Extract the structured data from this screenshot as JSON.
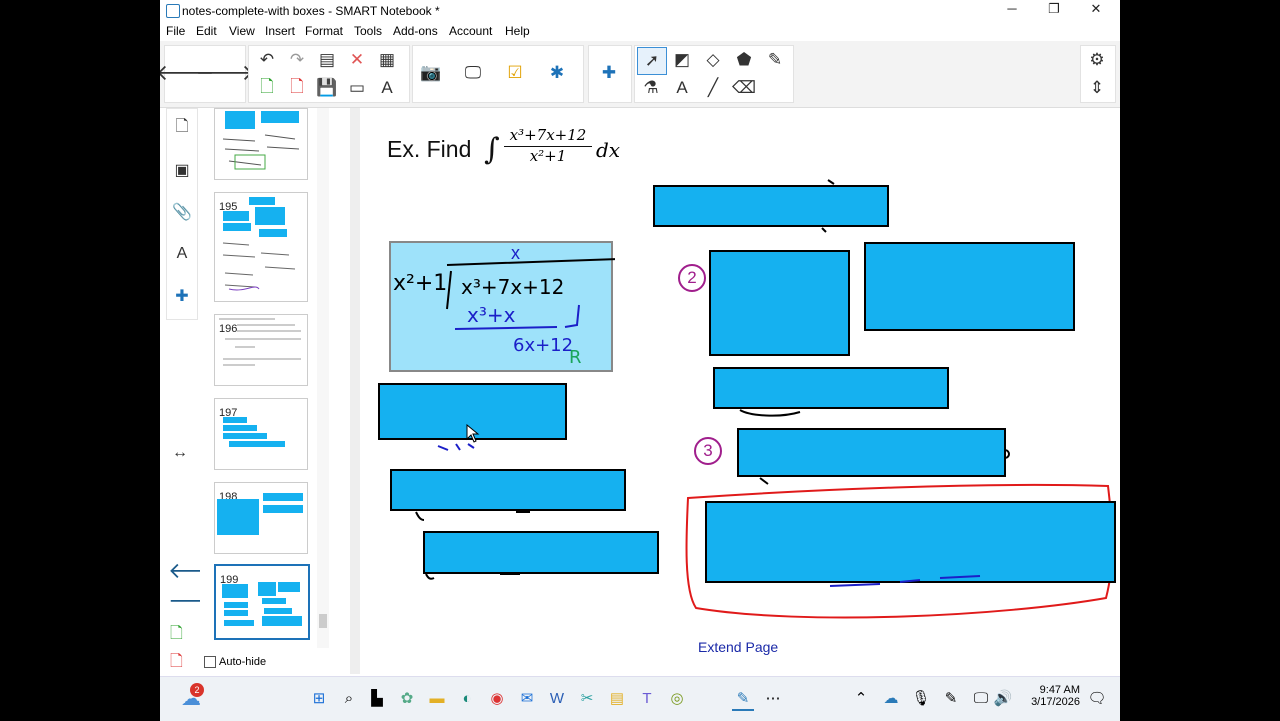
{
  "window": {
    "title": "notes-complete-with boxes - SMART Notebook *",
    "minimize": "─",
    "maximize": "❐",
    "close": "✕"
  },
  "menu": [
    "File",
    "Edit",
    "View",
    "Insert",
    "Format",
    "Tools",
    "Add-ons",
    "Account",
    "Help"
  ],
  "toolbar": {
    "back": "🡐",
    "forward": "🡒",
    "undo": "↶",
    "redo": "↷",
    "delete": "✕",
    "select_icon": "select-arrow-icon",
    "pen_icon": "pen-icon",
    "text_icon": "A"
  },
  "pages": [
    {
      "num": ""
    },
    {
      "num": "195"
    },
    {
      "num": "196"
    },
    {
      "num": "197"
    },
    {
      "num": "198"
    },
    {
      "num": "199"
    }
  ],
  "autohide_label": "Auto-hide",
  "canvas": {
    "prompt": "Ex. Find",
    "integral_num": "x³+7x+12",
    "integral_den": "x²+1",
    "dx": "dx",
    "work_divisor": "x²+1",
    "work_dividend": "x³+7x+12",
    "work_quotient": "x",
    "work_sub": "x³+x",
    "work_remainder": "6x+12",
    "work_r_label": "R",
    "circled_2": "2",
    "circled_3": "3",
    "extend_page": "Extend Page"
  },
  "taskbar": {
    "time": "9:47 AM",
    "date": "3/17/2026",
    "weather_badge": "2"
  }
}
